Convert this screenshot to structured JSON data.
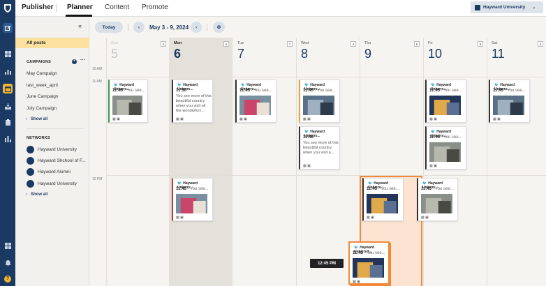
{
  "app": {
    "brand": "Publisher",
    "tabs": [
      "Planner",
      "Content",
      "Promote"
    ],
    "org": "Hayward University"
  },
  "sidebar": {
    "all_posts": "All posts",
    "campaigns_header": "CAMPAIGNS",
    "campaigns": [
      "May Campaign",
      "last_week_april",
      "June Campaign",
      "July Campaign"
    ],
    "show_all": "Show all",
    "networks_header": "NETWORKS",
    "networks": [
      "Hayward University",
      "Hayward Shchool of F...",
      "Hayward Alumni",
      "Hayward University"
    ]
  },
  "toolbar": {
    "today": "Today",
    "range": "May 3 - 9, 2024"
  },
  "times": [
    "10 AM",
    "11 AM",
    "12 PM"
  ],
  "days": [
    {
      "name": "Sun",
      "num": "5",
      "count": "3"
    },
    {
      "name": "Mon",
      "num": "6",
      "count": "6"
    },
    {
      "name": "Tue",
      "num": "7",
      "count": "7"
    },
    {
      "name": "Wed",
      "num": "8",
      "count": "4"
    },
    {
      "name": "Thu",
      "num": "9",
      "count": "8"
    },
    {
      "name": "Fri",
      "num": "10",
      "count": "9"
    },
    {
      "name": "Sat",
      "num": "11",
      "count": "3"
    }
  ],
  "post": {
    "account": "Hayward Univers...",
    "account2": "Hayward Universit...",
    "time1": "11:45",
    "time2": "11:10",
    "preview": "· You see...",
    "preview_long": "You see more of this beautiful country when you visit all the wonderful l...",
    "preview_long2": "You see more of this beautiful country when you visit a..."
  },
  "tooltip": "12:45 PM",
  "colors": {
    "brand_navy": "#1b3a63",
    "accent_yellow": "#f1b52e",
    "selected": "#fbe0a0",
    "drop_zone": "#fde3d2",
    "drop_border": "#f08a3a"
  }
}
